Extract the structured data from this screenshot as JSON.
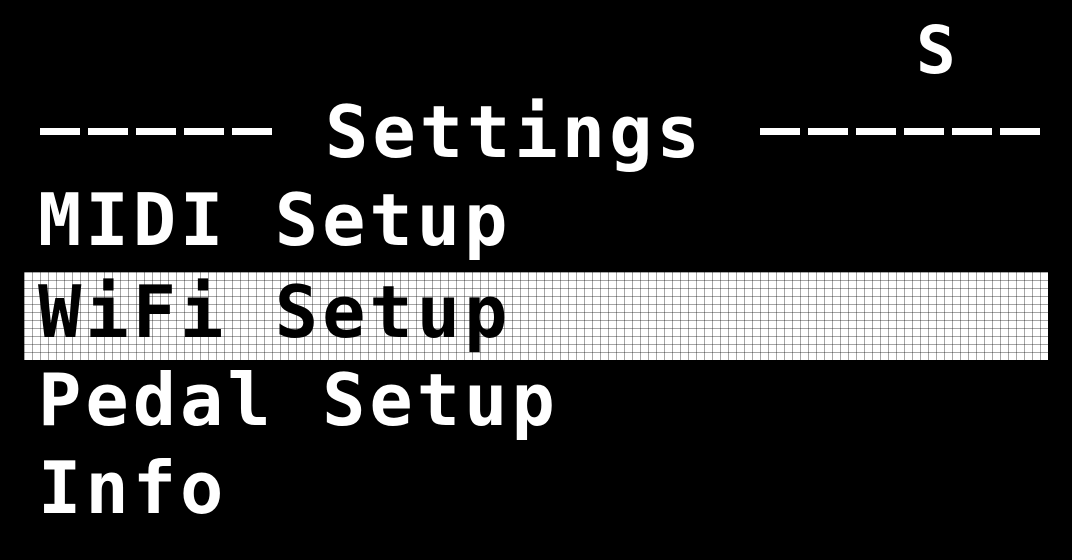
{
  "header": {
    "status_indicator": "S",
    "title": "Settings"
  },
  "menu": {
    "selected_index": 1,
    "items": [
      {
        "label": "MIDI Setup"
      },
      {
        "label": "WiFi Setup"
      },
      {
        "label": "Pedal Setup"
      },
      {
        "label": "Info"
      }
    ]
  },
  "colors": {
    "background": "#000000",
    "foreground": "#ffffff",
    "selected_text": "#000000"
  }
}
